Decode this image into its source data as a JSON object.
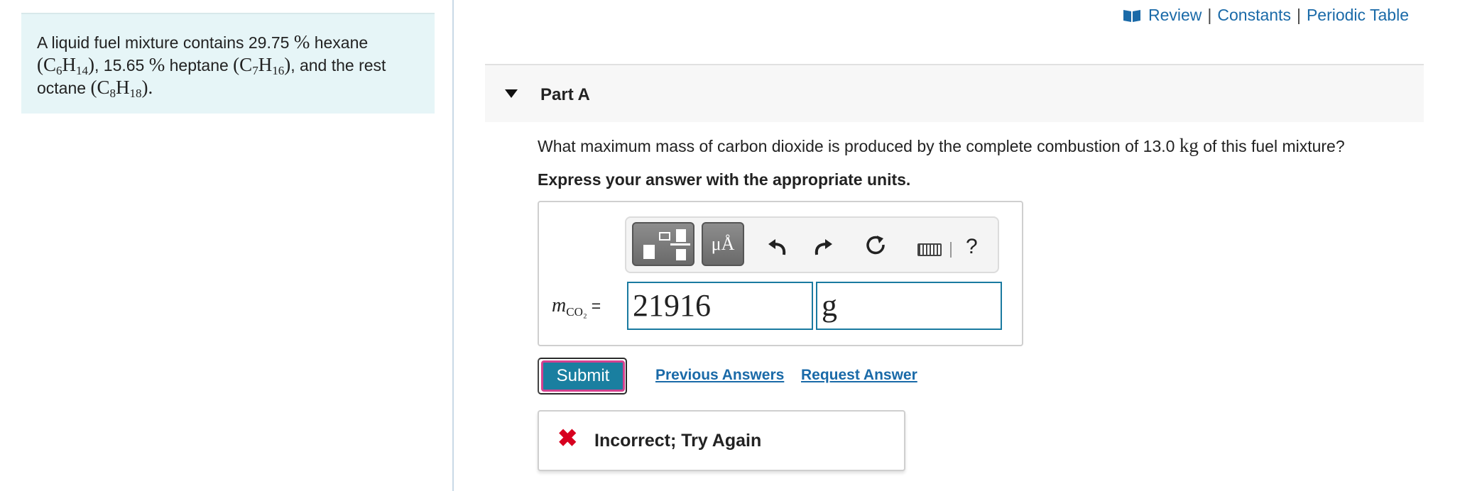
{
  "problem": {
    "line1_pre": "A liquid fuel mixture contains 29.75 ",
    "pct": "%",
    "line1_post": " hexane",
    "hexane_formula": [
      "C",
      "6",
      "H",
      "14"
    ],
    "line2_mid": ", 15.65 ",
    "line2_post": " heptane ",
    "heptane_formula": [
      "C",
      "7",
      "H",
      "16"
    ],
    "line2_end": ", and the rest",
    "line3_pre": "octane ",
    "octane_formula": [
      "C",
      "8",
      "H",
      "18"
    ],
    "line3_end": "."
  },
  "toplinks": {
    "review": "Review",
    "constants": "Constants",
    "periodic_table": "Periodic Table",
    "separator": "|"
  },
  "part": {
    "label": "Part A"
  },
  "question": {
    "text_pre": "What maximum mass of carbon dioxide is produced by the complete combustion of 13.0 ",
    "unit": "kg",
    "text_post": " of this fuel mixture?",
    "instruction": "Express your answer with the appropriate units."
  },
  "toolbar": {
    "templates_icon": "templates-icon",
    "units_button": "μÅ",
    "undo_icon": "undo-icon",
    "redo_icon": "redo-icon",
    "reset_icon": "reset-icon",
    "keyboard_icon": "keyboard-icon",
    "help_label": "?"
  },
  "answer": {
    "variable": "m",
    "variable_sub": "CO₂",
    "equals": "=",
    "value": "21916",
    "unit": "g"
  },
  "actions": {
    "submit": "Submit",
    "previous_answers": "Previous Answers",
    "request_answer": "Request Answer"
  },
  "feedback": {
    "icon": "x-icon",
    "message": "Incorrect; Try Again"
  },
  "colors": {
    "link": "#1a6aa8",
    "submit_bg": "#1a7fa0",
    "error_red": "#d7001f",
    "problem_bg": "#e6f5f7"
  }
}
